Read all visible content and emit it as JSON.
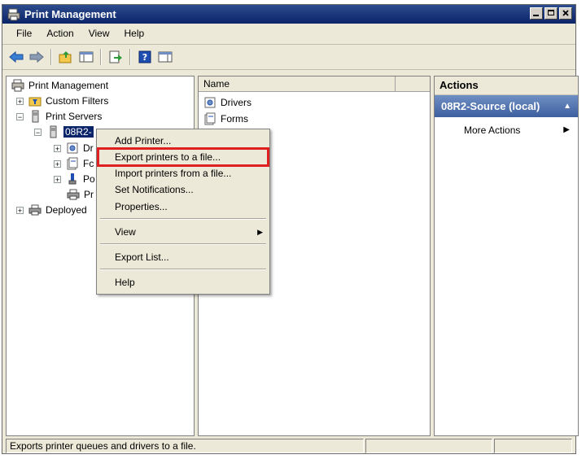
{
  "window": {
    "title": "Print Management"
  },
  "menu": [
    "File",
    "Action",
    "View",
    "Help"
  ],
  "tree": {
    "root": "Print Management",
    "custom_filters": "Custom Filters",
    "print_servers": "Print Servers",
    "server_selected": "08R2-",
    "drivers_partial": "Dr",
    "forms_partial": "Fc",
    "ports_partial": "Po",
    "printers_partial": "Pr",
    "deployed_partial": "Deployed"
  },
  "list": {
    "column_name": "Name",
    "items": [
      "Drivers",
      "Forms"
    ]
  },
  "context_menu": {
    "add_printer": "Add Printer...",
    "export_printers": "Export printers to a file...",
    "import_printers": "Import printers from a file...",
    "set_notifications": "Set Notifications...",
    "properties": "Properties...",
    "view": "View",
    "export_list": "Export List...",
    "help": "Help"
  },
  "actions": {
    "header": "Actions",
    "section": "08R2-Source (local)",
    "more_actions": "More Actions"
  },
  "status": {
    "text": "Exports printer queues and drivers to a file."
  },
  "colors": {
    "highlight_border": "#e02020",
    "selection": "#0a246a",
    "action_header": "#3d5f9e"
  }
}
